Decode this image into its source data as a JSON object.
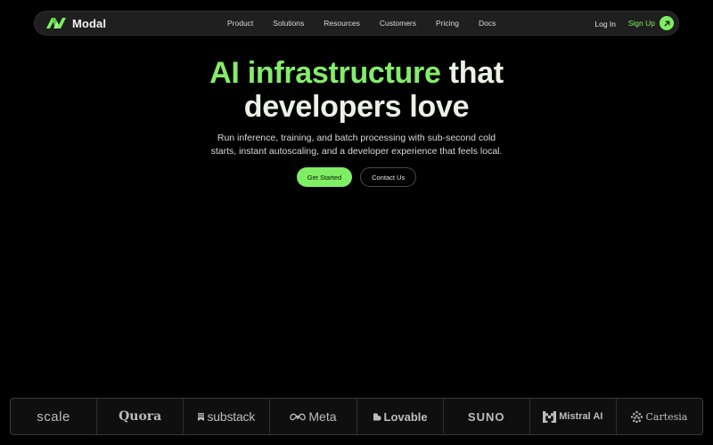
{
  "brand": {
    "name": "Modal",
    "logo_icon": "modal-logo-icon",
    "accent_color": "#7fee64"
  },
  "nav": {
    "items": [
      {
        "label": "Product"
      },
      {
        "label": "Solutions"
      },
      {
        "label": "Resources"
      },
      {
        "label": "Customers"
      },
      {
        "label": "Pricing"
      },
      {
        "label": "Docs"
      }
    ],
    "login_label": "Log In",
    "signup_label": "Sign Up",
    "signup_icon": "arrow-up-right-icon"
  },
  "hero": {
    "title_accent": "AI infrastructure",
    "title_rest_1": "that",
    "title_line_2": "developers love",
    "subtitle_line_1": "Run inference, training, and batch processing with sub-second cold",
    "subtitle_line_2": "starts, instant autoscaling, and a developer experience that feels local.",
    "primary_cta": "Get Started",
    "secondary_cta": "Contact Us"
  },
  "customer_logos": [
    {
      "name": "scale"
    },
    {
      "name": "Quora"
    },
    {
      "name": "substack",
      "icon": "substack-icon"
    },
    {
      "name": "Meta",
      "icon": "meta-infinity-icon"
    },
    {
      "name": "Lovable",
      "icon": "lovable-heart-icon"
    },
    {
      "name": "SUNO"
    },
    {
      "name": "Mistral AI",
      "icon": "mistral-m-icon"
    },
    {
      "name": "Cartesia",
      "icon": "cartesia-pixel-icon"
    }
  ]
}
